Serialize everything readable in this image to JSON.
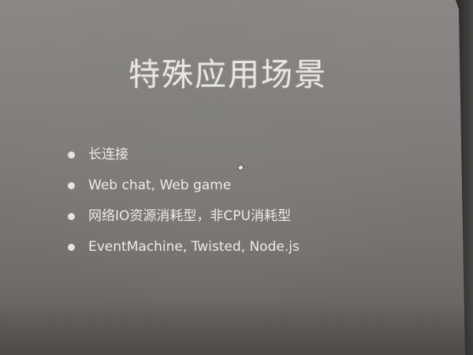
{
  "slide": {
    "title": "特殊应用场景",
    "bullets": [
      "长连接",
      "Web chat, Web game",
      "网络IO资源消耗型，非CPU消耗型",
      "EventMachine, Twisted, Node.js"
    ]
  },
  "icons": {
    "bullet": "bullet-dot-icon",
    "cursor": "hand-cursor-icon"
  },
  "colors": {
    "slide_background": "#807d7a",
    "text": "#ecebe8",
    "room": "#3a3936"
  }
}
